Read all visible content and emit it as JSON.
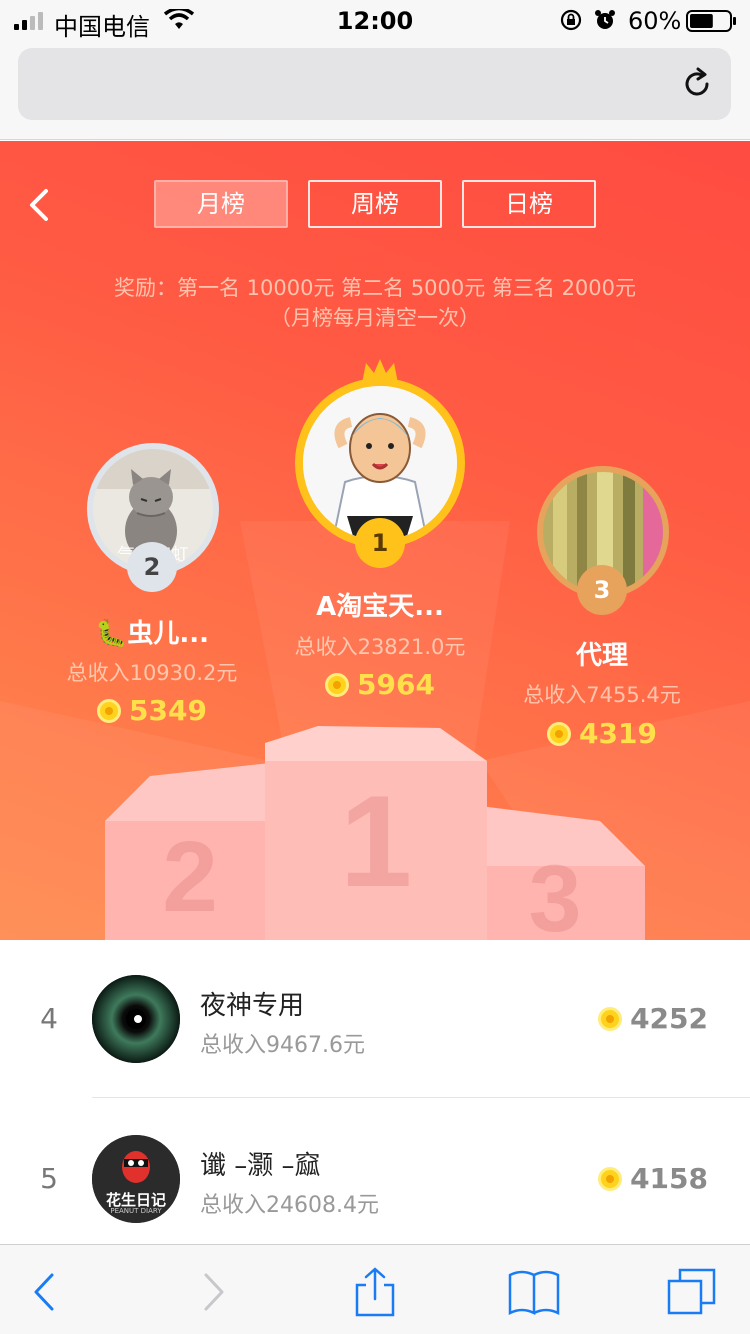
{
  "status_bar": {
    "carrier": "中国电信",
    "time": "12:00",
    "battery_percent": "60%",
    "battery_level": 0.6,
    "icons": [
      "signal-icon",
      "wifi-icon",
      "rotation-lock-icon",
      "alarm-icon",
      "battery-icon"
    ]
  },
  "address_bar": {
    "url": "",
    "reload_icon": "reload-icon"
  },
  "tabs": [
    {
      "label": "月榜",
      "active": true
    },
    {
      "label": "周榜",
      "active": false
    },
    {
      "label": "日榜",
      "active": false
    }
  ],
  "reward": {
    "line1": "奖励：第一名 10000元 第二名 5000元 第三名 2000元",
    "line2": "（月榜每月清空一次）"
  },
  "podium": {
    "first": {
      "rank": "1",
      "name": "A淘宝天...",
      "income": "总收入23821.0元",
      "coins": "5964"
    },
    "second": {
      "rank": "2",
      "name": "🐛虫儿...",
      "income": "总收入10930.2元",
      "coins": "5349",
      "avatar_watermark": "气势如虹"
    },
    "third": {
      "rank": "3",
      "name": "代理",
      "income": "总收入7455.4元",
      "coins": "4319"
    }
  },
  "list": [
    {
      "rank": "4",
      "name": "夜神专用",
      "income": "总收入9467.6元",
      "coins": "4252"
    },
    {
      "rank": "5",
      "name": "谶 –灏 –窳",
      "income": "总收入24608.4元",
      "coins": "4158",
      "avatar_text": "花生日记",
      "avatar_subtext": "PEANUT DIARY"
    }
  ],
  "colors": {
    "hero_top": "#ff4b42",
    "hero_bottom": "#ff8a4f",
    "coin": "#ffd21e",
    "gold_ring": "#ffc21a",
    "silver_ring": "#dfe4ea",
    "bronze_ring": "#e7a25c"
  },
  "toolbar": {
    "icons": [
      "back-arrow-icon",
      "forward-arrow-icon",
      "share-icon",
      "bookmarks-icon",
      "tabs-icon"
    ]
  }
}
